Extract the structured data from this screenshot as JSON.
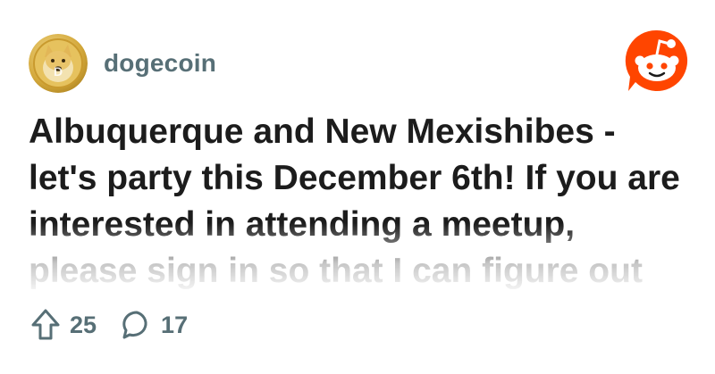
{
  "subreddit": {
    "name": "dogecoin",
    "avatar_icon": "doge-coin-icon"
  },
  "brand": {
    "logo_icon": "reddit-snoo-icon",
    "accent_color": "#ff4500"
  },
  "post": {
    "title": "Albuquerque and New Mexishibes - let's party this December 6th! If you are interested in attending a meetup, please sign in so that I can figure out"
  },
  "stats": {
    "upvote_icon": "upvote-arrow-icon",
    "upvotes": "25",
    "comment_icon": "comment-bubble-icon",
    "comments": "17"
  }
}
